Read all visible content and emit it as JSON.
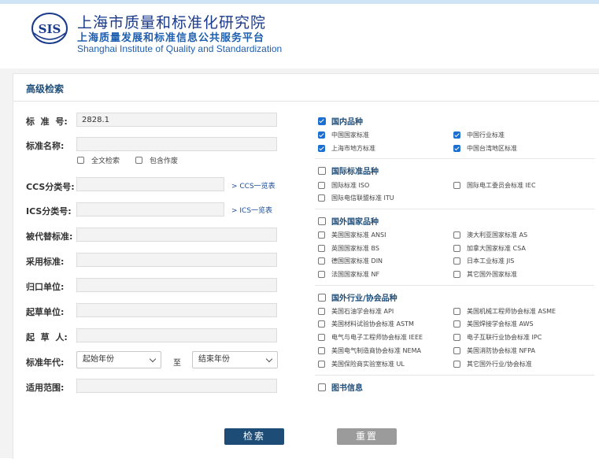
{
  "header": {
    "logo_text": "SIS",
    "title_cn": "上海市质量和标准化研究院",
    "subtitle_cn": "上海质量发展和标准信息公共服务平台",
    "title_en": "Shanghai Institute of Quality and Standardization"
  },
  "panel": {
    "title": "高级检索"
  },
  "form": {
    "std_no": {
      "label": "标  准  号:",
      "value": "2828.1"
    },
    "std_name": {
      "label": "标准名称:",
      "value": ""
    },
    "fulltext": {
      "label": "全文检索",
      "checked": false
    },
    "include_void": {
      "label": "包含作废",
      "checked": false
    },
    "ccs": {
      "label": "CCS分类号:",
      "value": "",
      "link": "> CCS一览表"
    },
    "ics": {
      "label": "ICS分类号:",
      "value": "",
      "link": "> ICS一览表"
    },
    "replaced": {
      "label": "被代替标准:",
      "value": ""
    },
    "adopted": {
      "label": "采用标准:",
      "value": ""
    },
    "dept": {
      "label": "归口单位:",
      "value": ""
    },
    "drafting_unit": {
      "label": "起草单位:",
      "value": ""
    },
    "drafter": {
      "label": "起  草  人:",
      "value": ""
    },
    "year": {
      "label": "标准年代:",
      "start": "起始年份",
      "to": "至",
      "end": "结束年份"
    },
    "scope": {
      "label": "适用范围:",
      "value": ""
    }
  },
  "groups": {
    "domestic": {
      "label": "国内品种",
      "checked": true,
      "items": [
        {
          "label": "中国国家标准",
          "checked": true
        },
        {
          "label": "中国行业标准",
          "checked": true
        },
        {
          "label": "上海市地方标准",
          "checked": true
        },
        {
          "label": "中国台湾地区标准",
          "checked": true
        }
      ]
    },
    "intl": {
      "label": "国际标准品种",
      "checked": false,
      "items": [
        {
          "label": "国际标准 ISO",
          "checked": false
        },
        {
          "label": "国际电工委员会标准 IEC",
          "checked": false
        },
        {
          "label": "国际电信联盟标准 ITU",
          "checked": false
        }
      ]
    },
    "foreign": {
      "label": "国外国家品种",
      "checked": false,
      "items": [
        {
          "label": "美国国家标准 ANSI",
          "checked": false
        },
        {
          "label": "澳大利亚国家标准 AS",
          "checked": false
        },
        {
          "label": "英国国家标准 BS",
          "checked": false
        },
        {
          "label": "加拿大国家标准 CSA",
          "checked": false
        },
        {
          "label": "德国国家标准 DIN",
          "checked": false
        },
        {
          "label": "日本工业标准 JIS",
          "checked": false
        },
        {
          "label": "法国国家标准 NF",
          "checked": false
        },
        {
          "label": "其它国外国家标准",
          "checked": false
        }
      ]
    },
    "industry": {
      "label": "国外行业/协会品种",
      "checked": false,
      "items": [
        {
          "label": "美国石油学会标准 API",
          "checked": false
        },
        {
          "label": "美国机械工程师协会标准 ASME",
          "checked": false
        },
        {
          "label": "美国材料试验协会标准 ASTM",
          "checked": false
        },
        {
          "label": "美国焊接学会标准 AWS",
          "checked": false
        },
        {
          "label": "电气与电子工程师协会标准 IEEE",
          "checked": false
        },
        {
          "label": "电子互联行业协会标准 IPC",
          "checked": false
        },
        {
          "label": "美国电气制造商协会标准 NEMA",
          "checked": false
        },
        {
          "label": "美国消防协会标准 NFPA",
          "checked": false
        },
        {
          "label": "美国保险商实验室标准 UL",
          "checked": false
        },
        {
          "label": "其它国外行业/协会标准",
          "checked": false
        }
      ]
    },
    "books": {
      "label": "图书信息",
      "checked": false
    }
  },
  "buttons": {
    "search": "检索",
    "reset": "重置"
  },
  "colors": {
    "accent": "#1f4e79",
    "checkbox": "#1a6fd1",
    "search_button": "#1d4d77",
    "reset_button": "#9b9b9b"
  }
}
